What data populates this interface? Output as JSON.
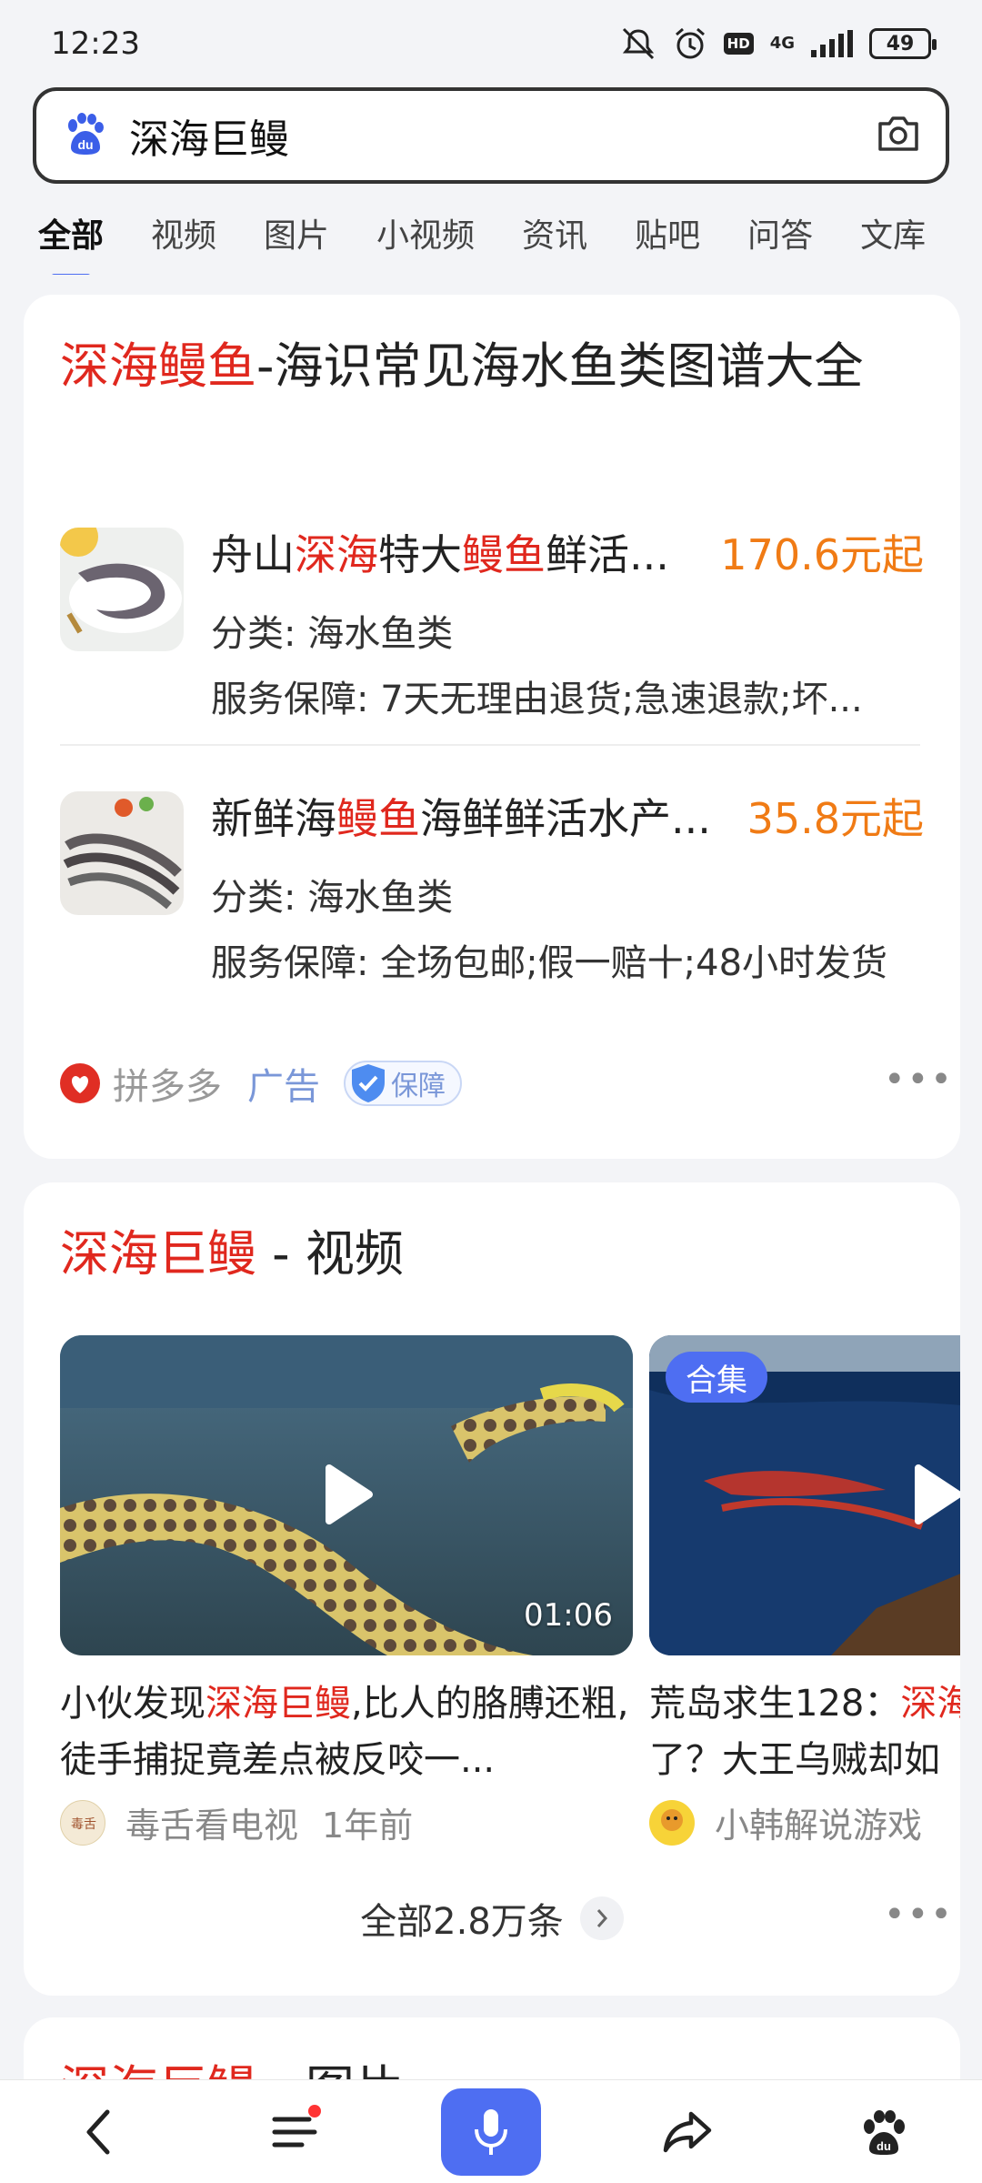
{
  "status_bar": {
    "time": "12:23",
    "network": "4G",
    "hd": "HD",
    "battery": "49"
  },
  "search": {
    "query": "深海巨鳗",
    "logo": "du"
  },
  "tabs": [
    "全部",
    "视频",
    "图片",
    "小视频",
    "资讯",
    "贴吧",
    "问答",
    "文库"
  ],
  "ad_card": {
    "title_hl": "深海鳗鱼",
    "title_rest": "-海识常见海水鱼类图谱大全",
    "products": [
      {
        "name_parts": [
          "舟山",
          "深海",
          "特大",
          "鳗鱼",
          "鲜活..."
        ],
        "price": "170.6元起",
        "category": "分类:  海水鱼类",
        "service": "服务保障:  7天无理由退货;急速退款;坏..."
      },
      {
        "name_parts": [
          "新鲜海",
          "鳗鱼",
          "海鲜鲜活水产...",
          "",
          ""
        ],
        "price": "35.8元起",
        "category": "分类:  海水鱼类",
        "service": "服务保障:  全场包邮;假一赔十;48小时发货"
      }
    ],
    "source": "拼多多",
    "ad_label": "广告",
    "guarantee": "保障",
    "more": "•••"
  },
  "video_card": {
    "title_hl": "深海巨鳗",
    "title_rest": " - 视频",
    "videos": [
      {
        "duration": "01:06",
        "title_pre": "小伙发现",
        "title_hl": "深海巨鳗",
        "title_post": ",比人的胳膊还粗,徒手捕捉竟差点被反咬一...",
        "author": "毒舌看电视",
        "time": "1年前"
      },
      {
        "badge": "合集",
        "title_pre": "荒岛求生128：",
        "title_hl": "深海",
        "title_post": "了？大王乌贼却如",
        "author": "小韩解说游戏",
        "time": ""
      }
    ],
    "see_all": "全部2.8万条",
    "more": "•••"
  },
  "next_card": {
    "title_hl": "深海巨鳗",
    "title_rest": " - 图片"
  },
  "bottom_nav": {
    "icons": [
      "back-icon",
      "menu-icon",
      "mic-icon",
      "share-icon",
      "baidu-paw-icon"
    ]
  },
  "colors": {
    "accent": "#4e6ef2",
    "highlight": "#e0281e",
    "price": "#f07b15"
  }
}
